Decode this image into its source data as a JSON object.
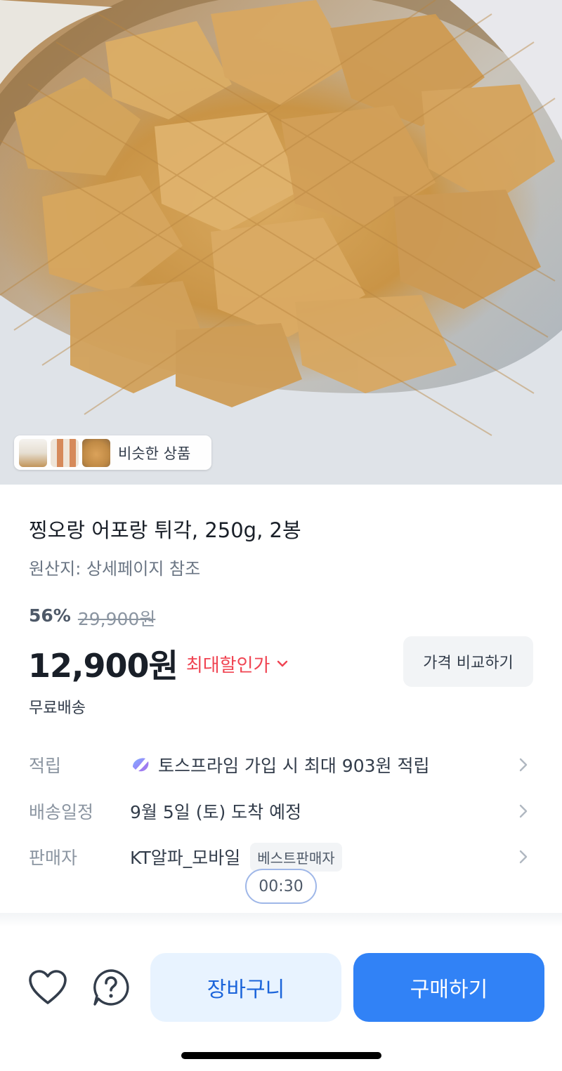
{
  "hero": {
    "image_name": "fried-seaweed-chips-photo",
    "similar_products_label": "비슷한 상품"
  },
  "product": {
    "title": "찡오랑 어포랑 튀각, 250g, 2봉",
    "origin": "원산지: 상세페이지 참조",
    "discount_rate": "56%",
    "original_price": "29,900원",
    "sale_price": "12,900원",
    "max_discount_label": "최대할인가",
    "compare_button": "가격 비교하기",
    "shipping_fee": "무료배송"
  },
  "info_rows": [
    {
      "label": "적립",
      "value": "토스프라임 가입 시 최대 903원 적립",
      "icon": "toss-prime-logo"
    },
    {
      "label": "배송일정",
      "value": "9월 5일 (토) 도착 예정"
    },
    {
      "label": "판매자",
      "value": "KT알파_모바일",
      "badge": "베스트판매자"
    }
  ],
  "timer": "00:30",
  "bottom_bar": {
    "wishlist_icon": "heart-icon",
    "help_icon": "question-icon",
    "cart_button": "장바구니",
    "buy_button": "구매하기"
  },
  "colors": {
    "accent_blue": "#3182f6",
    "cart_bg": "#e8f3ff",
    "cart_text": "#1b64da",
    "discount_red": "#f04452",
    "text_primary": "#191f28",
    "text_secondary": "#8b95a1"
  }
}
